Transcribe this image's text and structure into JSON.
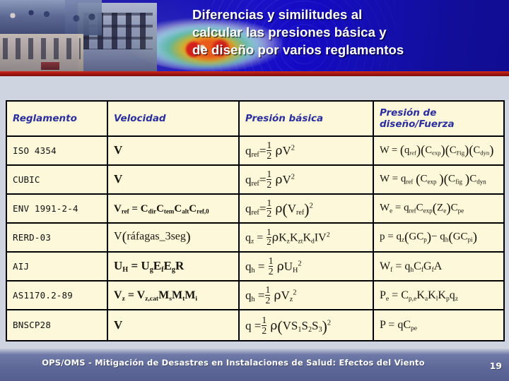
{
  "slide": {
    "title_lines": [
      "Diferencias y similitudes al",
      "calcular las presiones básica y",
      "de diseño por varios reglamentos"
    ],
    "accent_red": "#9e1410",
    "banner_blue": "#1410b4",
    "table_bg": "#fcf8d9",
    "header_text_color": "#2b2f9e"
  },
  "table": {
    "headers": {
      "reglamento": "Reglamento",
      "velocidad": "Velocidad",
      "presion_basica": "Presión básica",
      "presion_diseno": "Presión de diseño/Fuerza"
    },
    "rows": [
      {
        "reglamento": "ISO 4354",
        "velocidad": "V",
        "presion_basica": "q_ref = 1/2 ρ V²",
        "presion_diseno": "W = (q_ref)(C_exp)(C_Fig)(C_dyn)"
      },
      {
        "reglamento": "CUBIC",
        "velocidad": "V",
        "presion_basica": "q_ref = 1/2 ρ V²",
        "presion_diseno": "W = q_ref (C_exp)(C_fig)(C_dyn)"
      },
      {
        "reglamento": "ENV 1991-2-4",
        "velocidad": "V_ref = C_dir C_tem C_alt C_ref,0",
        "presion_basica": "q_ref = 1/2 ρ (V_ref)²",
        "presion_diseno": "W_e = q_ref C_exp (Z_e) C_pe"
      },
      {
        "reglamento": "RERD-03",
        "velocidad": "V(ráfagas_3seg)",
        "presion_basica": "q_z = 1/2 ρ K_z K_zt K_d I V²",
        "presion_diseno": "p = q_z (GC_p) − q_h (GC_pi)"
      },
      {
        "reglamento": "AIJ",
        "velocidad": "U_H = U_g E_f E_g R",
        "presion_basica": "q_h = 1/2 ρ U_H²",
        "presion_diseno": "W_f = q_h C_f G_f A"
      },
      {
        "reglamento": "AS1170.2-89",
        "velocidad": "V_z = V_z,cat M_s M_t M_i",
        "presion_basica": "q_h = 1/2 ρ V_z²",
        "presion_diseno": "P_e = C_p,e K_a K_l K_p q_z"
      },
      {
        "reglamento": "BNSCP28",
        "velocidad": "V",
        "presion_basica": "q = 1/2 ρ (V S₁ S₂ S₃)²",
        "presion_diseno": "P = q C_pe"
      }
    ]
  },
  "footer": {
    "text": "OPS/OMS - Mitigación de Desastres en Instalaciones de Salud: Efectos del Viento",
    "page_number": "19"
  }
}
